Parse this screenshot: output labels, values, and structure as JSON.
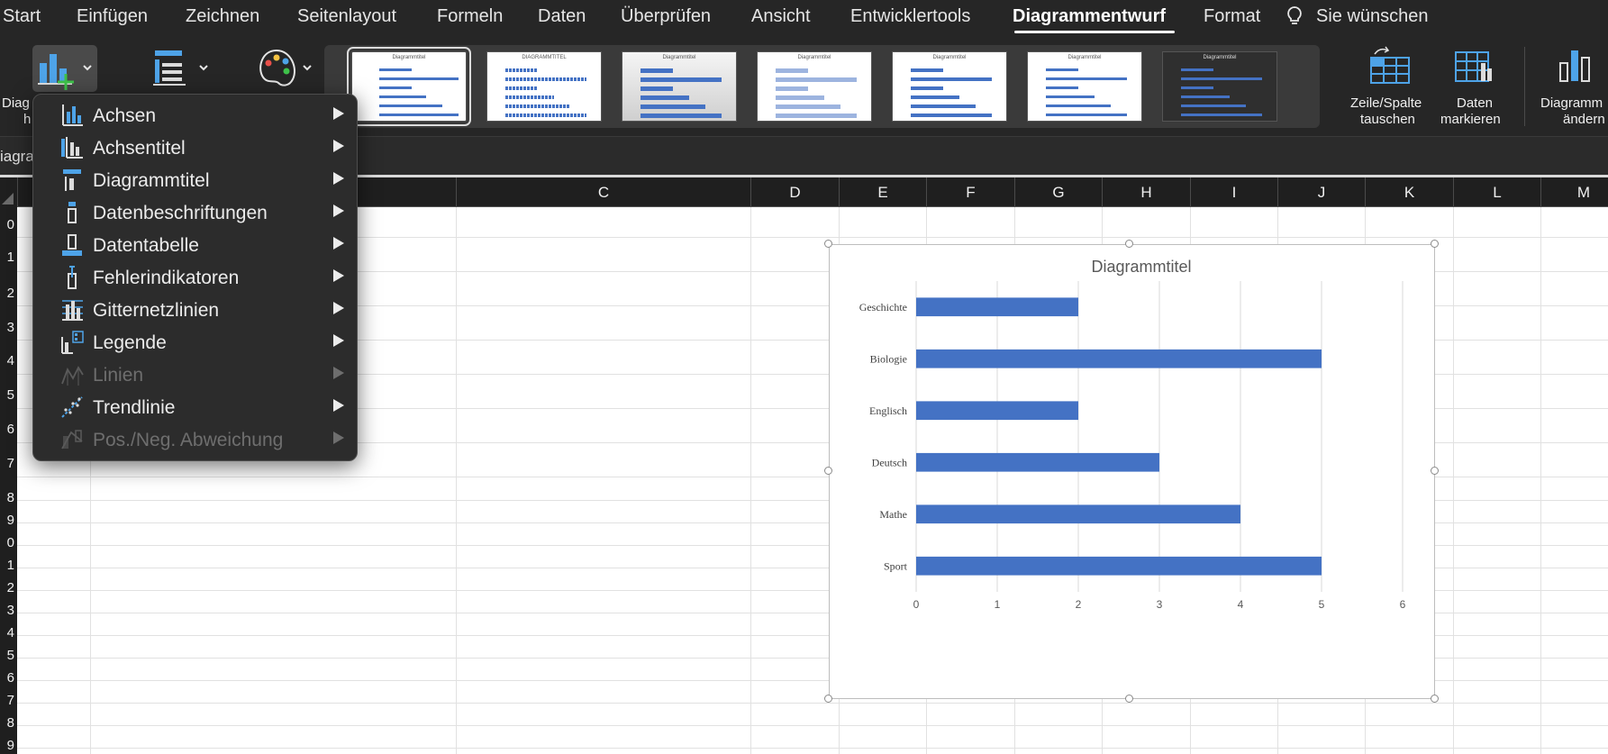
{
  "menu_tabs": [
    {
      "label": "Start",
      "active": false
    },
    {
      "label": "Einfügen",
      "active": false
    },
    {
      "label": "Zeichnen",
      "active": false
    },
    {
      "label": "Seitenlayout",
      "active": false
    },
    {
      "label": "Formeln",
      "active": false
    },
    {
      "label": "Daten",
      "active": false
    },
    {
      "label": "Überprüfen",
      "active": false
    },
    {
      "label": "Ansicht",
      "active": false
    },
    {
      "label": "Entwicklertools",
      "active": false
    },
    {
      "label": "Diagrammentwurf",
      "active": true
    },
    {
      "label": "Format",
      "active": false
    }
  ],
  "tell_me": "Sie wünschen",
  "ribbon": {
    "add_element_label_1": "Diag",
    "add_element_label_2": "h",
    "switch_row_col": [
      "Zeile/Spalte",
      "tauschen"
    ],
    "select_data": [
      "Daten",
      "markieren"
    ],
    "change_chart": [
      "Diagramm",
      "ändern"
    ],
    "gallery_arrow": "›",
    "style_thumb_title": "Diagrammtitel",
    "style_thumb_title_caps": "DIAGRAMMTITEL"
  },
  "namebox": "iagra",
  "columns": [
    "C",
    "D",
    "E",
    "F",
    "G",
    "H",
    "I",
    "J",
    "K",
    "L",
    "M"
  ],
  "row_numbers": [
    "0",
    "1",
    "2",
    "3",
    "4",
    "5",
    "6",
    "7",
    "8",
    "9",
    "0",
    "1",
    "2",
    "3",
    "4",
    "5",
    "6",
    "7",
    "8",
    "9"
  ],
  "chart_menu": {
    "items": [
      {
        "label": "Achsen",
        "icon": "axes-icon",
        "disabled": false
      },
      {
        "label": "Achsentitel",
        "icon": "axis-titles-icon",
        "disabled": false
      },
      {
        "label": "Diagrammtitel",
        "icon": "chart-title-icon",
        "disabled": false
      },
      {
        "label": "Datenbeschriftungen",
        "icon": "data-labels-icon",
        "disabled": false
      },
      {
        "label": "Datentabelle",
        "icon": "data-table-icon",
        "disabled": false
      },
      {
        "label": "Fehlerindikatoren",
        "icon": "error-bars-icon",
        "disabled": false
      },
      {
        "label": "Gitternetzlinien",
        "icon": "gridlines-icon",
        "disabled": false
      },
      {
        "label": "Legende",
        "icon": "legend-icon",
        "disabled": false
      },
      {
        "label": "Linien",
        "icon": "lines-icon",
        "disabled": true
      },
      {
        "label": "Trendlinie",
        "icon": "trendline-icon",
        "disabled": false
      },
      {
        "label": "Pos./Neg. Abweichung",
        "icon": "up-down-bars-icon",
        "disabled": true
      }
    ]
  },
  "colors": {
    "bar": "#4472c4",
    "ribbon": "#262626",
    "menu": "#2c2c2c"
  },
  "chart_data": {
    "type": "bar",
    "orientation": "horizontal",
    "title": "Diagrammtitel",
    "categories": [
      "Geschichte",
      "Biologie",
      "Englisch",
      "Deutsch",
      "Mathe",
      "Sport"
    ],
    "values": [
      2,
      5,
      2,
      3,
      4,
      5
    ],
    "xlim": [
      0,
      6
    ],
    "xticks": [
      "0",
      "1",
      "2",
      "3",
      "4",
      "5",
      "6"
    ],
    "xlabel": "",
    "ylabel": "",
    "grid": "vertical",
    "legend": "none"
  }
}
